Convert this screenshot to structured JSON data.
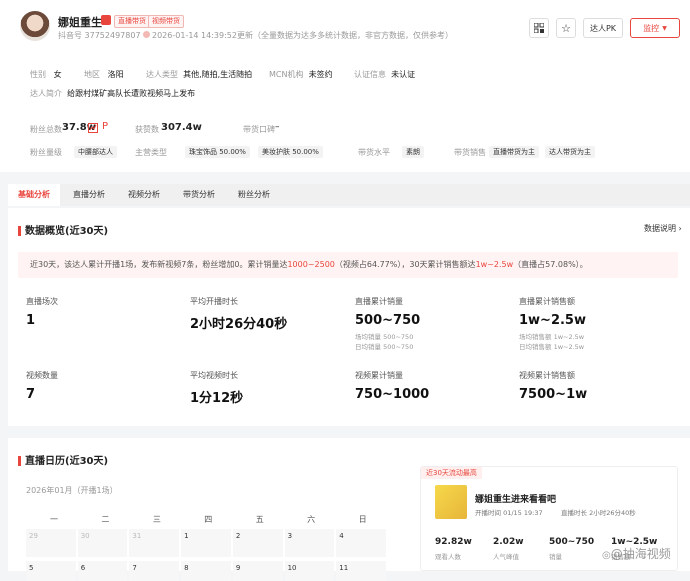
{
  "profile": {
    "name": "娜姐重生",
    "tags": [
      "直播带货",
      "视频带货"
    ],
    "id_text": "抖音号 37752497807",
    "updated": "2026-01-14 14:39:52更新（全量数据为达多多统计数据，非官方数据，仅供参考）",
    "buttons": {
      "pk": "达人PK",
      "monitor": "监控"
    }
  },
  "info": [
    {
      "label": "性别",
      "value": "女"
    },
    {
      "label": "地区",
      "value": "洛阳"
    },
    {
      "label": "达人类型",
      "value": "其他,随拍,生活随拍"
    },
    {
      "label": "MCN机构",
      "value": "未签约"
    },
    {
      "label": "认证信息",
      "value": "未认证"
    }
  ],
  "intro": {
    "label": "达人简介",
    "value": "给跟村煤矿高队长遭败视频马上发布"
  },
  "metrics": {
    "fans_label": "粉丝总数",
    "fans_value": "37.8w",
    "fans_trend": "P",
    "likes_label": "获赞数",
    "likes_value": "307.4w",
    "cargo_label": "带货口碑",
    "cargo_value": "–",
    "fans_level_label": "粉丝量级",
    "fans_level_chip": "中腰部达人",
    "main_cat_label": "主营类型",
    "main_cats": [
      "珠宝饰品 50.00%",
      "美妆护肤 50.00%"
    ],
    "level_label": "带货水平",
    "level_chip": "素朗",
    "method_label": "带货销售",
    "methods": [
      "直播带货为主",
      "达人带货为主"
    ]
  },
  "tabs": [
    "基础分析",
    "直播分析",
    "视频分析",
    "带货分析",
    "粉丝分析"
  ],
  "overview": {
    "title": "数据概览(近30天)",
    "link": "数据说明",
    "summary_a": "近30天，该达人累计开播1场，发布新视频7条，粉丝增加0。累计销量达",
    "summary_b": "1000~2500",
    "summary_c": "（视频占64.77%），30天累计销售额达",
    "summary_d": "1w~2.5w",
    "summary_e": "（直播占57.08%）。",
    "stats": [
      {
        "label": "直播场次",
        "value": "1",
        "subs": []
      },
      {
        "label": "平均开播时长",
        "value": "2小时26分40秒",
        "subs": []
      },
      {
        "label": "直播累计销量",
        "value": "500~750",
        "subs": [
          "场均销量 500~750",
          "日均销量 500~750"
        ]
      },
      {
        "label": "直播累计销售额",
        "value": "1w~2.5w",
        "subs": [
          "场均销售额 1w~2.5w",
          "日均销售额 1w~2.5w"
        ]
      },
      {
        "label": "视频数量",
        "value": "7",
        "subs": []
      },
      {
        "label": "平均视频时长",
        "value": "1分12秒",
        "subs": []
      },
      {
        "label": "视频累计销量",
        "value": "750~1000",
        "subs": []
      },
      {
        "label": "视频累计销售额",
        "value": "7500~1w",
        "subs": []
      }
    ]
  },
  "calendar": {
    "title": "直播日历(近30天)",
    "month": "2026年01月（开播1场）",
    "weekdays": [
      "一",
      "二",
      "三",
      "四",
      "五",
      "六",
      "日"
    ],
    "row1": [
      "29",
      "30",
      "31",
      "1",
      "2",
      "3",
      "4"
    ],
    "row2": [
      "5",
      "6",
      "7",
      "8",
      "9",
      "10",
      "11"
    ]
  },
  "live": {
    "badge": "近30天流动最高",
    "title": "娜姐重生进来看看吧",
    "time": "开播时间 01/15 19:37",
    "duration": "直播时长 2小时26分40秒",
    "values": [
      "92.82w",
      "2.02w",
      "500~750",
      "1w~2.5w"
    ],
    "labels": [
      "观看人数",
      "人气峰值",
      "销量",
      "销售额"
    ]
  },
  "watermark": "@抽海视频"
}
